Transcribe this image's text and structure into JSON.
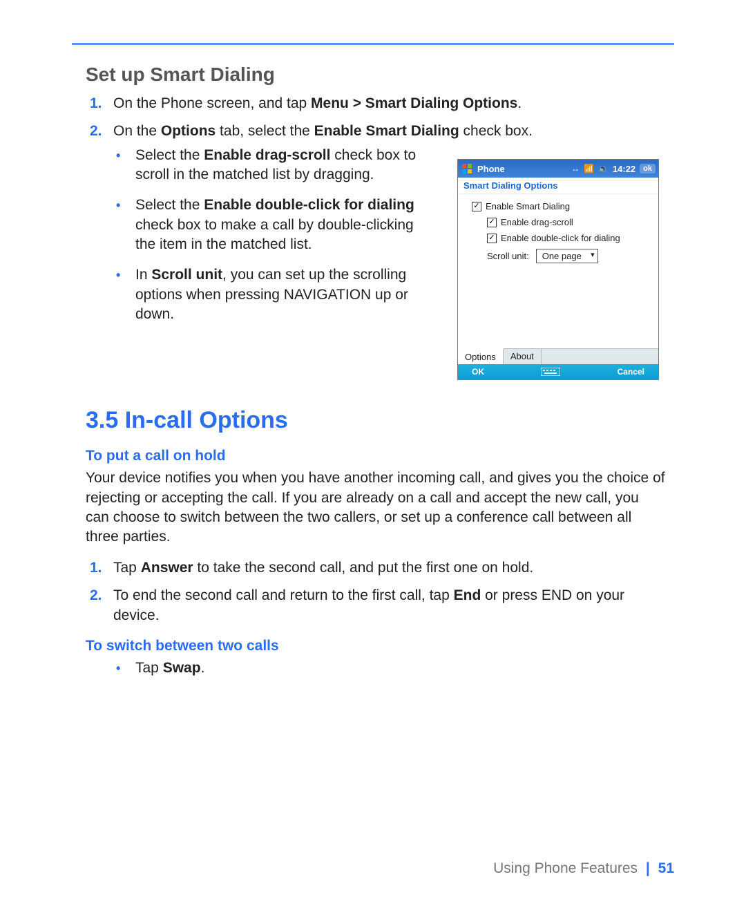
{
  "heading_setup": "Set up Smart Dialing",
  "step1_pre": "On the Phone screen, and tap ",
  "step1_bold": "Menu > Smart Dialing Options",
  "step1_post": ".",
  "step2_pre": "On the ",
  "step2_b1": "Options",
  "step2_mid": " tab, select the ",
  "step2_b2": "Enable Smart Dialing",
  "step2_post": " check box.",
  "b1_pre": "Select the ",
  "b1_bold": "Enable drag-scroll",
  "b1_post": " check box to scroll in the matched list by dragging.",
  "b2_pre": "Select the ",
  "b2_bold": "Enable double-click for dialing",
  "b2_post": " check box to make a call by double-clicking the item in the matched list.",
  "b3_pre": "In ",
  "b3_bold": "Scroll unit",
  "b3_post": ", you can set up the scrolling options when pressing NAVIGATION up or down.",
  "section_35": "3.5  In-call Options",
  "sub_hold": "To put a call on hold",
  "hold_para": "Your device notifies you when you have another incoming call, and gives you the choice of rejecting or accepting the call. If you are already on a call and accept the new call, you can choose to switch between the two callers, or set up a conference call between all three parties.",
  "hold1_pre": "Tap ",
  "hold1_bold": "Answer",
  "hold1_post": " to take the second call, and put the first one on hold.",
  "hold2_pre": "To end the second call and return to the first call, tap ",
  "hold2_bold": "End",
  "hold2_post": " or press END on your device.",
  "sub_switch": "To switch between two calls",
  "swap_pre": "Tap ",
  "swap_bold": "Swap",
  "swap_post": ".",
  "footer_text": "Using Phone Features",
  "footer_page": "51",
  "phone": {
    "title": "Phone",
    "time": "14:22",
    "ok": "ok",
    "subtitle": "Smart Dialing Options",
    "check1": "Enable Smart Dialing",
    "check2": "Enable drag-scroll",
    "check3": "Enable double-click for dialing",
    "scroll_label": "Scroll unit:",
    "scroll_value": "One page",
    "tab_options": "Options",
    "tab_about": "About",
    "btn_ok": "OK",
    "btn_cancel": "Cancel"
  }
}
